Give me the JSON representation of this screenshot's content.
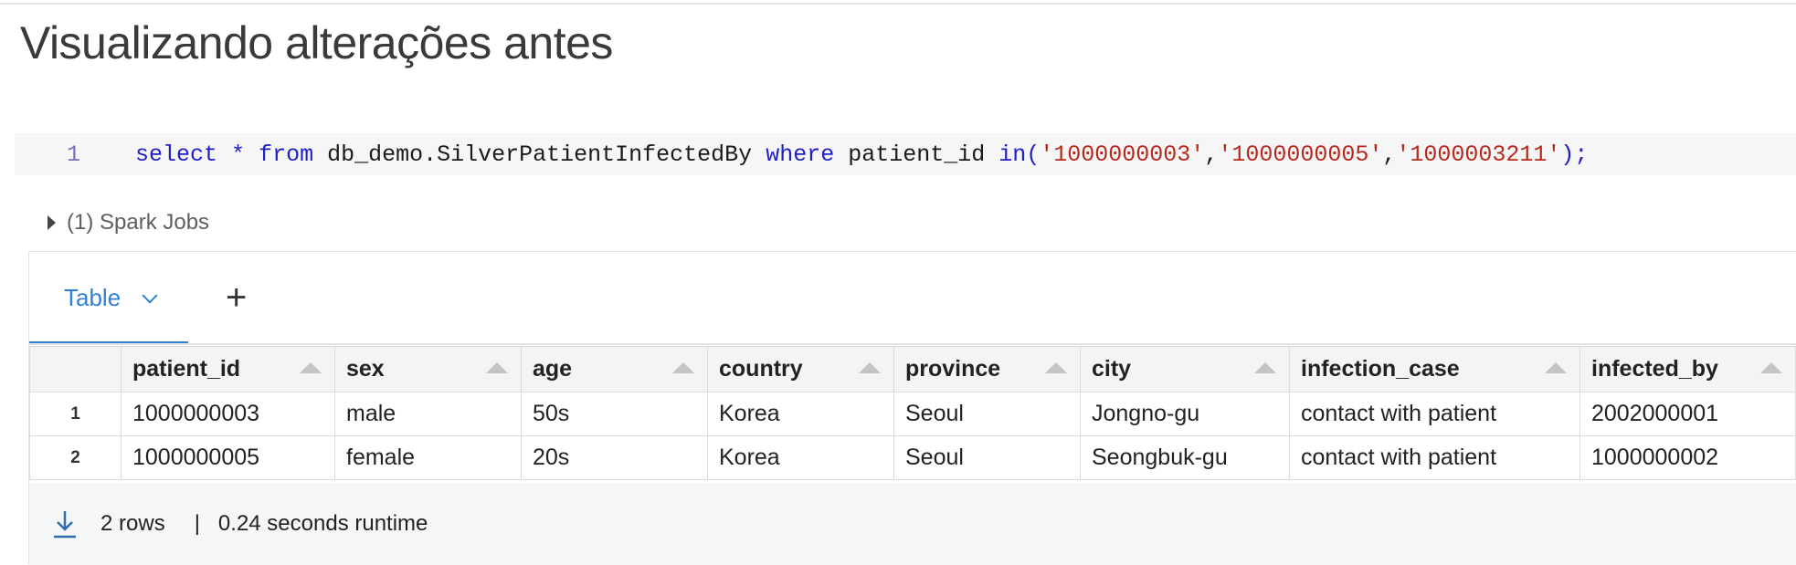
{
  "title": "Visualizando alterações antes",
  "code": {
    "line_number": "1",
    "tokens": {
      "kw_select": "select",
      "star": "*",
      "kw_from": "from",
      "table": "db_demo.SilverPatientInfectedBy",
      "kw_where": "where",
      "column": "patient_id",
      "kw_in": "in(",
      "id1": "'1000000003'",
      "comma1": ",",
      "id2": "'1000000005'",
      "comma2": ",",
      "id3": "'1000003211'",
      "close": ");"
    }
  },
  "spark_jobs": "(1) Spark Jobs",
  "tabs": {
    "active": "Table",
    "add": "+"
  },
  "columns": [
    "patient_id",
    "sex",
    "age",
    "country",
    "province",
    "city",
    "infection_case",
    "infected_by"
  ],
  "rows": [
    {
      "num": "1",
      "cells": [
        "1000000003",
        "male",
        "50s",
        "Korea",
        "Seoul",
        "Jongno-gu",
        "contact with patient",
        "2002000001"
      ]
    },
    {
      "num": "2",
      "cells": [
        "1000000005",
        "female",
        "20s",
        "Korea",
        "Seoul",
        "Seongbuk-gu",
        "contact with patient",
        "1000000002"
      ]
    }
  ],
  "footer": {
    "rows": "2 rows",
    "sep": "|",
    "runtime": "0.24 seconds runtime"
  },
  "colors": {
    "accent": "#2f80d6",
    "keyword": "#1f1fc8",
    "string": "#b52a1d",
    "line_number": "#7b6fb6"
  },
  "icons": [
    "caret-right-icon",
    "chevron-down-icon",
    "plus-icon",
    "sort-up-icon",
    "download-icon"
  ]
}
